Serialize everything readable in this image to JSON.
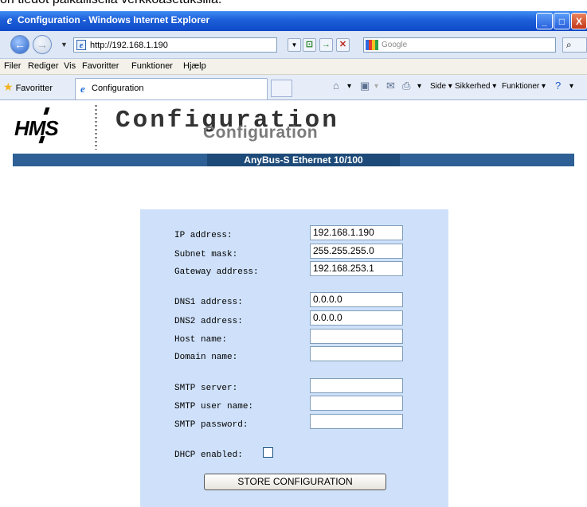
{
  "page_top_text": "on tiedot paikallisella verkkoasetuksilla.",
  "window": {
    "title": "Configuration - Windows Internet Explorer",
    "minimize_glyph": "_",
    "maximize_glyph": "□",
    "close_glyph": "X"
  },
  "address_bar": {
    "url": "http://192.168.1.190",
    "back_glyph": "←",
    "forward_glyph": "→",
    "go_glyph": "→",
    "stop_glyph": "✕",
    "search_placeholder": "Google",
    "search_glyph": "⌕"
  },
  "menu": [
    "Filer",
    "Rediger",
    "Vis",
    "Favoritter",
    "Funktioner",
    "Hjælp"
  ],
  "favorites_bar": {
    "favorites_label": "Favoritter",
    "tab_label": "Configuration",
    "commands": [
      "Side ▾",
      "Sikkerhed ▾",
      "Funktioner ▾"
    ]
  },
  "header": {
    "logo_text": "HMS",
    "title": "Configuration",
    "title_shadow": "Configuration",
    "band_label": "AnyBus-S Ethernet 10/100"
  },
  "form": {
    "fields": [
      {
        "label": "IP address:",
        "value": "192.168.1.190"
      },
      {
        "label": "Subnet mask:",
        "value": "255.255.255.0"
      },
      {
        "label": "Gateway address:",
        "value": "192.168.253.1"
      },
      {
        "label": "DNS1 address:",
        "value": "0.0.0.0"
      },
      {
        "label": "DNS2 address:",
        "value": "0.0.0.0"
      },
      {
        "label": "Host name:",
        "value": ""
      },
      {
        "label": "Domain name:",
        "value": ""
      },
      {
        "label": "SMTP server:",
        "value": ""
      },
      {
        "label": "SMTP user name:",
        "value": ""
      },
      {
        "label": "SMTP password:",
        "value": ""
      }
    ],
    "dhcp_label": "DHCP enabled:",
    "dhcp_checked": false,
    "submit_label": "STORE CONFIGURATION"
  },
  "colors": {
    "panel": "#cfe1fa",
    "band": "#2e5f95",
    "titlebar": "#1c5ed8"
  }
}
